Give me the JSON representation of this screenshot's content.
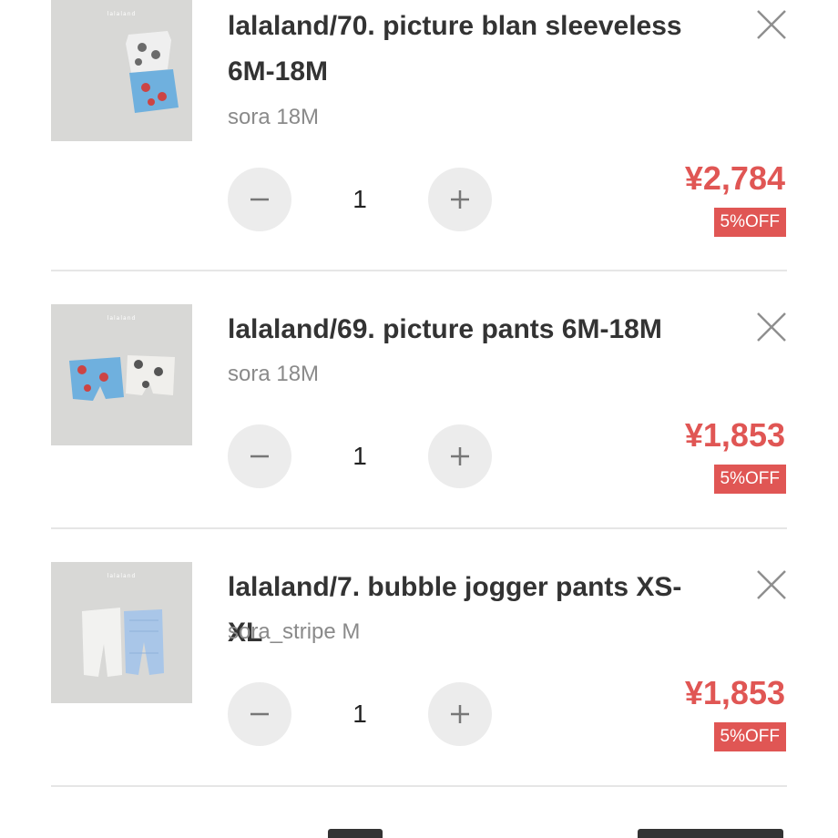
{
  "cart_items": [
    {
      "title_line1": "lalaland/70. picture blan sleeveless",
      "title_line2": "6M-18M",
      "variant": "sora 18M",
      "quantity": "1",
      "price": "¥2,784",
      "discount_badge": "5%OFF",
      "thumb_brand": "lalaland"
    },
    {
      "title_line1": "lalaland/69. picture pants 6M-18M",
      "title_line2": "",
      "variant": "sora 18M",
      "quantity": "1",
      "price": "¥1,853",
      "discount_badge": "5%OFF",
      "thumb_brand": "lalaland"
    },
    {
      "title_line1": "lalaland/7. bubble jogger pants XS-XL",
      "title_line2": "",
      "variant": "sora_stripe M",
      "quantity": "1",
      "price": "¥1,853",
      "discount_badge": "5%OFF",
      "thumb_brand": "lalaland"
    }
  ],
  "colors": {
    "accent_red": "#e05654",
    "button_bg": "#ececec",
    "divider": "#e6e6e6",
    "thumb_bg": "#d7d7d5"
  },
  "icons": [
    "close-icon",
    "minus-icon",
    "plus-icon"
  ]
}
